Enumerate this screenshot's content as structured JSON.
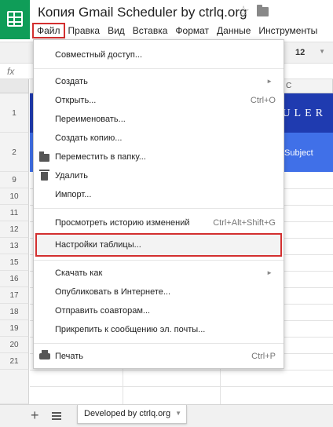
{
  "header": {
    "title": "Копия Gmail Scheduler by ctrlq.org",
    "star_glyph": "☆"
  },
  "menubar": {
    "items": [
      "Файл",
      "Правка",
      "Вид",
      "Вставка",
      "Формат",
      "Данные",
      "Инструменты"
    ]
  },
  "toolbar": {
    "font_size": "12"
  },
  "formula": {
    "fx": "fx"
  },
  "grid": {
    "rows": [
      "1",
      "2",
      "9",
      "10",
      "11",
      "12",
      "13",
      "15",
      "16",
      "17",
      "18",
      "19",
      "20",
      "21"
    ],
    "col_c": "C",
    "banner_text": "EDULER",
    "subject_text": "Subject"
  },
  "file_menu": {
    "share": "Совместный доступ...",
    "create": "Создать",
    "open": "Открыть...",
    "open_shortcut": "Ctrl+O",
    "rename": "Переименовать...",
    "make_copy": "Создать копию...",
    "move_to_folder": "Переместить в папку...",
    "delete": "Удалить",
    "import": "Импорт...",
    "revision_history": "Просмотреть историю изменений",
    "revision_shortcut": "Ctrl+Alt+Shift+G",
    "spreadsheet_settings": "Настройки таблицы...",
    "download_as": "Скачать как",
    "publish": "Опубликовать в Интернете...",
    "email_collaborators": "Отправить соавторам...",
    "email_attachment": "Прикрепить к сообщению эл. почты...",
    "print": "Печать",
    "print_shortcut": "Ctrl+P"
  },
  "bottom": {
    "add_glyph": "+",
    "sheet_tab": "Developed by ctrlq.org"
  },
  "colors": {
    "accent_red": "#d32f2f",
    "banner_blue": "#1f3bb0",
    "subject_blue": "#4070e8",
    "sheets_green": "#0f9d58"
  }
}
